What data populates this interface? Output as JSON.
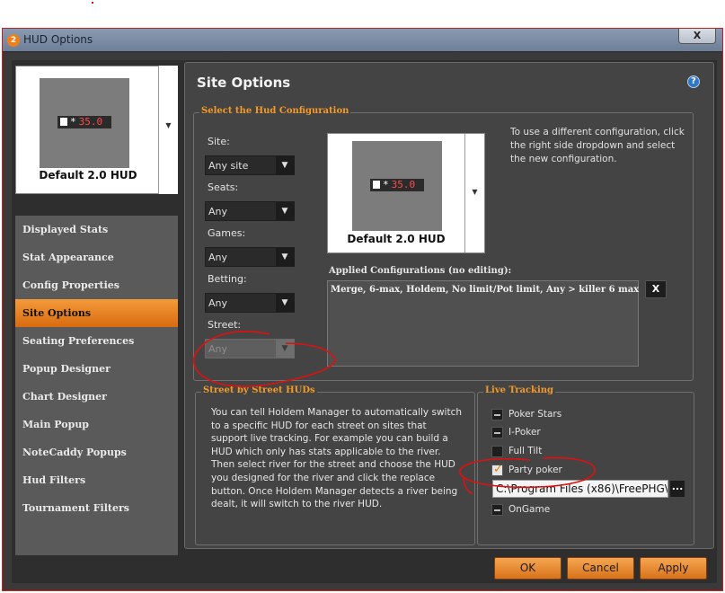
{
  "window": {
    "title": "HUD Options",
    "app_icon_glyph": "2",
    "close_label": "X"
  },
  "hud_preview": {
    "name": "Default 2.0 HUD",
    "stat_value": "35.0",
    "stat_star": "*"
  },
  "nav": {
    "items": [
      "Displayed Stats",
      "Stat Appearance",
      "Config Properties",
      "Site Options",
      "Seating Preferences",
      "Popup Designer",
      "Chart Designer",
      "Main Popup",
      "NoteCaddy Popups",
      "Hud Filters",
      "Tournament Filters"
    ],
    "active_index": 3
  },
  "panel": {
    "title": "Site Options",
    "help_glyph": "?"
  },
  "hud_config": {
    "group_title": "Select the Hud Configuration",
    "site_label": "Site:",
    "site_value": "Any site",
    "seats_label": "Seats:",
    "seats_value": "Any",
    "games_label": "Games:",
    "games_value": "Any",
    "betting_label": "Betting:",
    "betting_value": "Any",
    "street_label": "Street:",
    "street_value": "Any",
    "hint": "To use a different configuration, click the right side dropdown and select the new configuration.",
    "applied_label": "Applied Configurations (no editing):",
    "applied_value": "Merge, 6-max, Holdem, No limit/Pot limit, Any > killer 6 max",
    "remove_label": "X"
  },
  "street_huds": {
    "group_title": "Street by Street HUDs",
    "description": "You can tell Holdem Manager to automatically switch to a specific HUD for each street on sites that support live tracking. For example you can build a HUD which only has stats applicable to the river. Then select river for the street and choose the HUD you designed for the river and click the replace button. Once Holdem Manager detects a river being dealt, it will switch to the river HUD."
  },
  "live_tracking": {
    "group_title": "Live Tracking",
    "sites": [
      {
        "label": "Poker Stars",
        "state": "partial"
      },
      {
        "label": "I-Poker",
        "state": "partial"
      },
      {
        "label": "Full Tilt",
        "state": "off"
      },
      {
        "label": "Party poker",
        "state": "on"
      },
      {
        "label": "OnGame",
        "state": "partial"
      }
    ],
    "party_path": "C:\\Program Files (x86)\\FreePHG\\",
    "browse_label": "..."
  },
  "footer": {
    "ok_label": "OK",
    "cancel_label": "Cancel",
    "apply_label": "Apply"
  },
  "colors": {
    "accent_orange": "#f39a2a",
    "annotation_red": "#e01010",
    "frame_border": "#c82020"
  }
}
